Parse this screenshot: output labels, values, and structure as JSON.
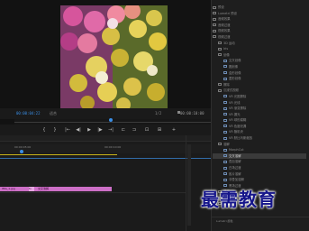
{
  "monitor": {
    "timecode_left": "00:00:04:22",
    "fit": "适合",
    "fraction": "1/2",
    "timecode_right": "00:00:10:00"
  },
  "transport": [
    "{",
    "}",
    "|←",
    "◀|",
    "▶",
    "|▶",
    "→|",
    "⊏",
    "⊐",
    "⊡",
    "⊞",
    "+"
  ],
  "timeline": {
    "ruler_t1": "00:00:05:00",
    "ruler_t2": "00:00:10:00",
    "clip_a": "IMG_1.jpg",
    "clip_fx": "fx",
    "clip_b": "交叉溶解"
  },
  "effects": [
    {
      "label": "预设",
      "indent": 0,
      "type": "folder",
      "selected": false
    },
    {
      "label": "Lumetri 预设",
      "indent": 0,
      "type": "folder",
      "selected": false
    },
    {
      "label": "音频效果",
      "indent": 0,
      "type": "folder",
      "selected": false
    },
    {
      "label": "音频过渡",
      "indent": 0,
      "type": "folder",
      "selected": false
    },
    {
      "label": "视频效果",
      "indent": 0,
      "type": "folder",
      "selected": false
    },
    {
      "label": "视频过渡",
      "indent": 0,
      "type": "folder",
      "selected": false
    },
    {
      "label": "3D 运动",
      "indent": 1,
      "type": "folder",
      "selected": false
    },
    {
      "label": "Iris",
      "indent": 1,
      "type": "folder",
      "selected": false
    },
    {
      "label": "划像",
      "indent": 1,
      "type": "folder",
      "selected": false
    },
    {
      "label": "交叉划像",
      "indent": 2,
      "type": "fx",
      "selected": false
    },
    {
      "label": "圆划像",
      "indent": 2,
      "type": "fx",
      "selected": false
    },
    {
      "label": "盒形划像",
      "indent": 2,
      "type": "fx",
      "selected": false
    },
    {
      "label": "菱形划像",
      "indent": 2,
      "type": "fx",
      "selected": false
    },
    {
      "label": "擦除",
      "indent": 1,
      "type": "folder",
      "selected": false
    },
    {
      "label": "沉浸式视频",
      "indent": 1,
      "type": "folder",
      "selected": false
    },
    {
      "label": "VR 光圈擦除",
      "indent": 2,
      "type": "fx",
      "selected": false
    },
    {
      "label": "VR 光线",
      "indent": 2,
      "type": "fx",
      "selected": false
    },
    {
      "label": "VR 渐变擦除",
      "indent": 2,
      "type": "fx",
      "selected": false
    },
    {
      "label": "VR 漏光",
      "indent": 2,
      "type": "fx",
      "selected": false
    },
    {
      "label": "VR 球形模糊",
      "indent": 2,
      "type": "fx",
      "selected": false
    },
    {
      "label": "VR 色度泄漏",
      "indent": 2,
      "type": "fx",
      "selected": false
    },
    {
      "label": "VR 随机块",
      "indent": 2,
      "type": "fx",
      "selected": false
    },
    {
      "label": "VR 默比乌斯缩放",
      "indent": 2,
      "type": "fx",
      "selected": false
    },
    {
      "label": "溶解",
      "indent": 1,
      "type": "folder",
      "selected": false
    },
    {
      "label": "MorphCut",
      "indent": 2,
      "type": "fx",
      "selected": false
    },
    {
      "label": "交叉溶解",
      "indent": 2,
      "type": "fx",
      "selected": true
    },
    {
      "label": "叠加溶解",
      "indent": 2,
      "type": "fx",
      "selected": false
    },
    {
      "label": "白场过渡",
      "indent": 2,
      "type": "fx",
      "selected": false
    },
    {
      "label": "胶片溶解",
      "indent": 2,
      "type": "fx",
      "selected": false
    },
    {
      "label": "非叠加溶解",
      "indent": 2,
      "type": "fx",
      "selected": false
    },
    {
      "label": "黑场过渡",
      "indent": 2,
      "type": "fx",
      "selected": false
    },
    {
      "label": "滑动",
      "indent": 1,
      "type": "folder",
      "selected": false
    },
    {
      "label": "缩放",
      "indent": 1,
      "type": "folder",
      "selected": false
    },
    {
      "label": "页面剥落",
      "indent": 1,
      "type": "folder",
      "selected": false
    }
  ],
  "effects_footer": "Lumetri 颜色",
  "watermark": "最需教育",
  "colors": {
    "accent": "#3a8ee6",
    "clip": "#cc6fc6",
    "in_out": "#c8b41a"
  }
}
